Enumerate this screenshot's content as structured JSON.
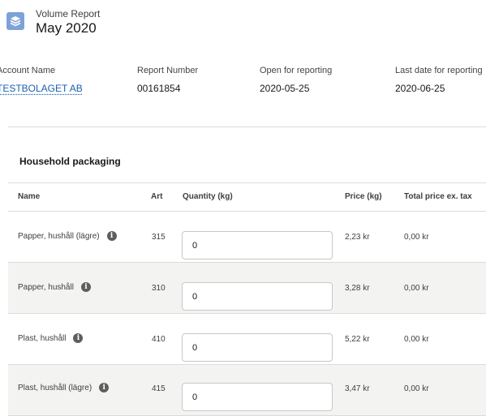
{
  "header": {
    "icon": "stacked-layers-icon",
    "icon_color": "#7da2d8",
    "subtitle": "Volume Report",
    "title": "May 2020"
  },
  "fields": [
    {
      "label": "Account Name",
      "value": "TESTBOLAGET AB",
      "link": true
    },
    {
      "label": "Report Number",
      "value": "00161854"
    },
    {
      "label": "Open for reporting",
      "value": "2020-05-25"
    },
    {
      "label": "Last date for reporting",
      "value": "2020-06-25"
    }
  ],
  "section": {
    "title": "Household packaging"
  },
  "table": {
    "columns": [
      "Name",
      "Art",
      "Quantity (kg)",
      "Price (kg)",
      "Total price ex. tax"
    ],
    "rows": [
      {
        "name": "Papper, hushåll (lägre)",
        "art": "315",
        "quantity": "0",
        "price": "2,23 kr",
        "total": "0,00 kr"
      },
      {
        "name": "Papper, hushåll",
        "art": "310",
        "quantity": "0",
        "price": "3,28 kr",
        "total": "0,00 kr"
      },
      {
        "name": "Plast, hushåll",
        "art": "410",
        "quantity": "0",
        "price": "5,22 kr",
        "total": "0,00 kr"
      },
      {
        "name": "Plast, hushåll (lägre)",
        "art": "415",
        "quantity": "0",
        "price": "3,47 kr",
        "total": "0,00 kr"
      }
    ]
  },
  "colors": {
    "link": "#1b5fb0",
    "alt_row": "#f3f4f2",
    "divider": "#dddbda"
  }
}
